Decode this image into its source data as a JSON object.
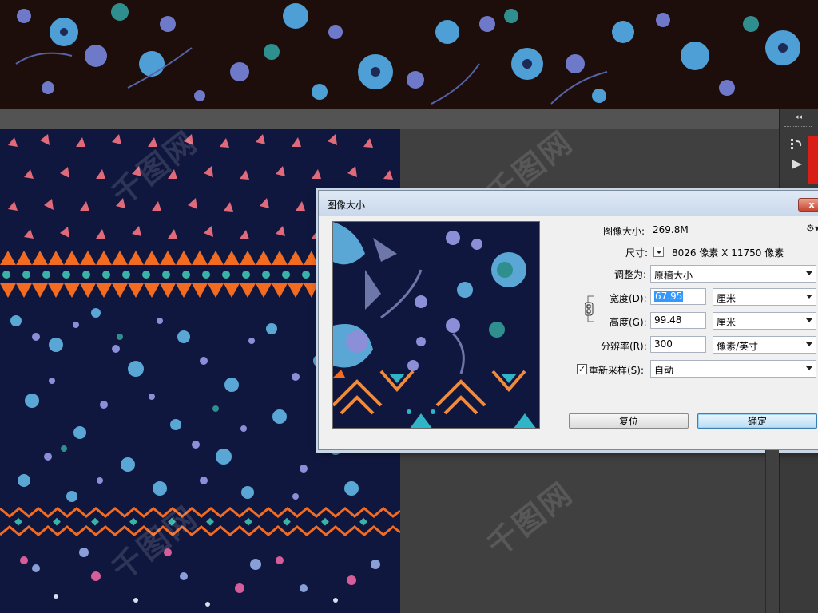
{
  "dialog": {
    "title": "图像大小",
    "close_label": "x",
    "image_size_label": "图像大小:",
    "image_size_value": "269.8M",
    "dimensions_label": "尺寸:",
    "dimensions_value": "8026 像素  X  11750 像素",
    "adjust_label": "调整为:",
    "adjust_value": "原稿大小",
    "width_label": "宽度(D):",
    "width_value": "67.95",
    "width_unit": "厘米",
    "height_label": "高度(G):",
    "height_value": "99.48",
    "height_unit": "厘米",
    "resolution_label": "分辨率(R):",
    "resolution_value": "300",
    "resolution_unit": "像素/英寸",
    "resample_label": "重新采样(S):",
    "resample_checked": true,
    "resample_value": "自动",
    "reset_label": "复位",
    "ok_label": "确定"
  },
  "panel": {
    "collapse_label": "◂◂"
  },
  "watermark": {
    "text": "千图网"
  },
  "colors": {
    "navy": "#10173f",
    "coral": "#e0697a",
    "orange": "#f26b21",
    "teal": "#3bb2a8",
    "blue": "#5aa7d6",
    "lavender": "#8a8fd8"
  }
}
